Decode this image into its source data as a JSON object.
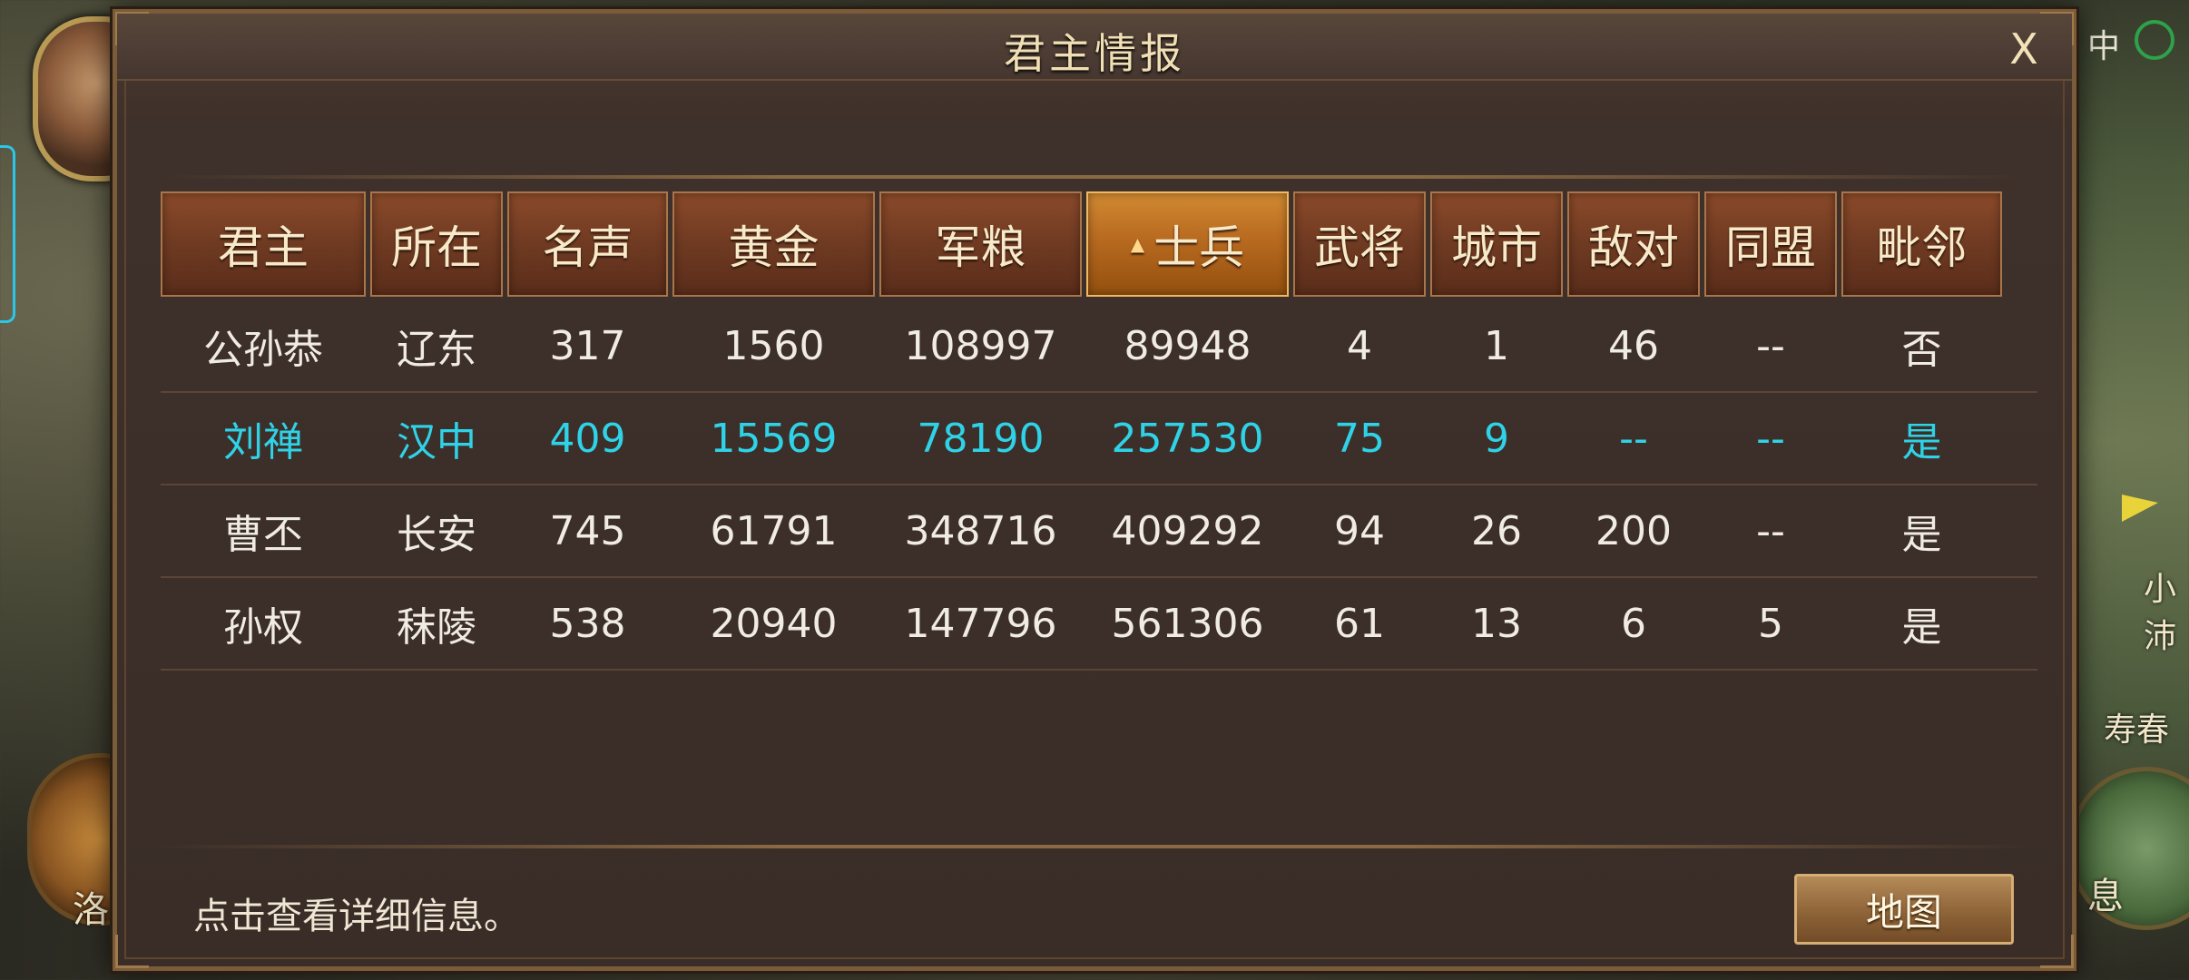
{
  "background": {
    "top_right_text": "中",
    "labels": [
      "小沛",
      "寿春",
      "洛",
      "息"
    ]
  },
  "dialog": {
    "title": "君主情报",
    "close_label": "X",
    "hint": "点击查看详细信息。",
    "map_button": "地图"
  },
  "table": {
    "columns": [
      "君主",
      "所在",
      "名声",
      "黄金",
      "军粮",
      "士兵",
      "武将",
      "城市",
      "敌对",
      "同盟",
      "毗邻"
    ],
    "sorted_column_index": 5,
    "sort_icon": "sort-ascending-icon",
    "highlight_color": "#2fd3e8",
    "rows": [
      {
        "cells": [
          "公孙恭",
          "辽东",
          "317",
          "1560",
          "108997",
          "89948",
          "4",
          "1",
          "46",
          "--",
          "否"
        ]
      },
      {
        "cells": [
          "刘禅",
          "汉中",
          "409",
          "15569",
          "78190",
          "257530",
          "75",
          "9",
          "--",
          "--",
          "是"
        ],
        "highlight": true
      },
      {
        "cells": [
          "曹丕",
          "长安",
          "745",
          "61791",
          "348716",
          "409292",
          "94",
          "26",
          "200",
          "--",
          "是"
        ]
      },
      {
        "cells": [
          "孙权",
          "秣陵",
          "538",
          "20940",
          "147796",
          "561306",
          "61",
          "13",
          "6",
          "5",
          "是"
        ]
      }
    ]
  }
}
